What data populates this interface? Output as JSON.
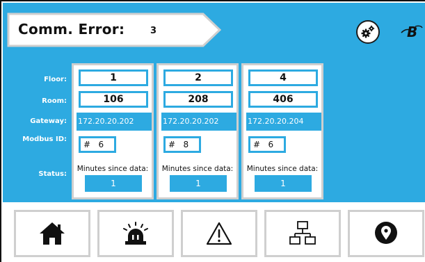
{
  "header": {
    "title": "Comm. Error:",
    "count": "3"
  },
  "labels": {
    "floor": "Floor:",
    "room": "Room:",
    "gateway": "Gateway:",
    "modbus_id": "Modbus ID:",
    "status": "Status:"
  },
  "cards": [
    {
      "floor": "1",
      "room": "106",
      "gateway": "172.20.20.202",
      "modbus_id": "#   6",
      "minutes_label": "Minutes since data:",
      "minutes": "1"
    },
    {
      "floor": "2",
      "room": "208",
      "gateway": "172.20.20.202",
      "modbus_id": "#   8",
      "minutes_label": "Minutes since data:",
      "minutes": "1"
    },
    {
      "floor": "4",
      "room": "406",
      "gateway": "172.20.20.204",
      "modbus_id": "#   6",
      "minutes_label": "Minutes since data:",
      "minutes": "1"
    }
  ],
  "nav": [
    {
      "icon": "home-icon"
    },
    {
      "icon": "alarm-light-icon"
    },
    {
      "icon": "warning-icon"
    },
    {
      "icon": "network-icon"
    },
    {
      "icon": "location-pin-icon"
    }
  ],
  "colors": {
    "accent": "#2daae1",
    "card_border": "#cfcfcf",
    "text": "#111111"
  }
}
